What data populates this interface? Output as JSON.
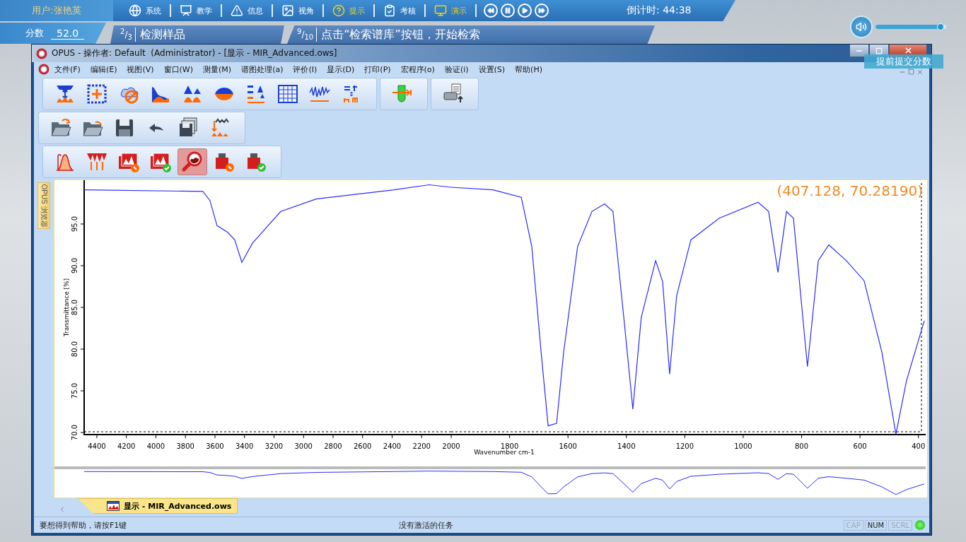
{
  "header": {
    "user": "用户:张艳英",
    "score_label": "分数",
    "score": "52.0",
    "nav": [
      {
        "kind": "globe",
        "label": "系统",
        "highlighted": false
      },
      {
        "kind": "teach",
        "label": "教学",
        "highlighted": false
      },
      {
        "kind": "warning",
        "label": "信息",
        "highlighted": false
      },
      {
        "kind": "picture",
        "label": "视角",
        "highlighted": false
      },
      {
        "kind": "help",
        "label": "提示",
        "highlighted": true
      },
      {
        "kind": "clipboard",
        "label": "考核",
        "highlighted": false
      },
      {
        "kind": "monitor",
        "label": "演示",
        "highlighted": true
      }
    ],
    "media": [
      {
        "kind": "rewind"
      },
      {
        "kind": "pause"
      },
      {
        "kind": "play"
      },
      {
        "kind": "forward"
      }
    ],
    "countdown": "倒计时: 44:38",
    "steps": [
      {
        "fraction": "$^{2}$/$_{3}$",
        "label": "检测样品"
      },
      {
        "fraction": "$^{9}$/$_{10}$",
        "label": "点击“检索谱库”按钮，开始检索"
      }
    ],
    "volume": {
      "level": 0.97
    }
  },
  "submit_button": "提前提交分数",
  "window": {
    "title": "OPUS - 操作者: Default  (Administrator) - [显示 - MIR_Advanced.ows]",
    "menu": [
      "文件(F)",
      "编辑(E)",
      "视图(V)",
      "窗口(W)",
      "测量(M)",
      "谱图处理(a)",
      "评价(I)",
      "显示(D)",
      "打印(P)",
      "宏程序(o)",
      "验证(i)",
      "设置(S)",
      "帮助(H)"
    ],
    "toolbars": [
      [
        [
          {
            "kind": "zoom-vertical",
            "selected": false
          },
          {
            "kind": "zoom-all",
            "selected": false
          },
          {
            "kind": "cloud",
            "selected": false
          },
          {
            "kind": "baseline",
            "selected": false
          },
          {
            "kind": "peaks",
            "selected": false
          },
          {
            "kind": "wave",
            "selected": false
          },
          {
            "kind": "subtract",
            "selected": false
          },
          {
            "kind": "table",
            "selected": false
          },
          {
            "kind": "noise",
            "selected": false
          },
          {
            "kind": "units",
            "selected": false
          }
        ],
        [
          {
            "kind": "tube",
            "selected": false
          }
        ],
        [
          {
            "kind": "printer",
            "selected": false
          }
        ]
      ],
      [
        [
          {
            "kind": "open",
            "selected": false
          },
          {
            "kind": "open-recent",
            "selected": false
          },
          {
            "kind": "save",
            "selected": false
          },
          {
            "kind": "undo",
            "selected": false
          },
          {
            "kind": "save-all",
            "selected": false
          },
          {
            "kind": "load",
            "selected": false
          }
        ]
      ],
      [
        [
          {
            "kind": "peak-curve",
            "selected": false
          },
          {
            "kind": "peak-pick",
            "selected": false
          },
          {
            "kind": "report-repair",
            "selected": false
          },
          {
            "kind": "report-check",
            "selected": false
          },
          {
            "kind": "search",
            "selected": true
          },
          {
            "kind": "weight-repair",
            "selected": false
          },
          {
            "kind": "weight-check",
            "selected": false
          }
        ]
      ]
    ],
    "side_tab": "OPUS 浏览器",
    "spectrum": [
      {
        "chart_data": {
          "type": "line",
          "ylabel": "Transmittance [%]",
          "xlim": [
            4486,
            2000
          ],
          "ylim": [
            69.75,
            100.25
          ],
          "xticks": [
            4400,
            4200,
            4000,
            3800,
            3600,
            3400,
            3200,
            3000,
            2800,
            2600,
            2400,
            2200,
            2000
          ],
          "yticks": [
            {
              "value": 70,
              "label": "70.0"
            },
            {
              "value": 75,
              "label": "75.0"
            },
            {
              "value": 80,
              "label": "80.0"
            },
            {
              "value": 85,
              "label": "85.0"
            },
            {
              "value": 90,
              "label": "90.0"
            },
            {
              "value": 95,
              "label": "95.0"
            }
          ],
          "x": [
            4486,
            3682,
            3634,
            3586,
            3514,
            3466,
            3418,
            3346,
            3155,
            2915,
            2580,
            2388,
            2149,
            2000
          ],
          "series": [
            {
              "color": "#2b2bff",
              "values": [
                99.1,
                98.9,
                97.8,
                94.8,
                94.0,
                93.1,
                90.4,
                92.7,
                96.5,
                98.0,
                98.7,
                99.1,
                99.7,
                99.4
              ]
            }
          ]
        }
      },
      {
        "chart_data": {
          "type": "line",
          "xlabel": "Wavenumber cm-1",
          "xlim": [
            2000,
            380
          ],
          "ylim": [
            69.75,
            100.25
          ],
          "xticks": [
            1800,
            1600,
            1400,
            1200,
            1000,
            800,
            600,
            400
          ],
          "x": [
            2000,
            1857,
            1760,
            1724,
            1692,
            1668,
            1639,
            1615,
            1567,
            1518,
            1475,
            1446,
            1409,
            1378,
            1349,
            1300,
            1276,
            1252,
            1228,
            1179,
            1082,
            949,
            913,
            881,
            852,
            828,
            780,
            743,
            707,
            647,
            586,
            525,
            477,
            441,
            380
          ],
          "series": [
            {
              "color": "#2b2bff",
              "values": [
                99.4,
                99.1,
                98.2,
                92.3,
                79.6,
                70.8,
                71.1,
                79.6,
                92.3,
                96.5,
                97.4,
                96.5,
                83.8,
                72.8,
                83.8,
                90.6,
                88.1,
                77.0,
                86.4,
                93.1,
                95.7,
                97.6,
                96.5,
                89.2,
                96.5,
                95.7,
                77.9,
                90.6,
                92.5,
                90.6,
                88.2,
                79.6,
                69.8,
                76.2,
                83.4
              ]
            }
          ],
          "annotations": [
            "(407.128, 70.28190)"
          ]
        }
      }
    ],
    "tabs": [
      {
        "label": "显示 - MIR_Advanced.ows",
        "selected": true
      }
    ],
    "status_bar": {
      "help": "要想得到帮助，请按F1键",
      "task": "没有激活的任务",
      "indicators": [
        {
          "label": "CAP",
          "on": false
        },
        {
          "label": "NUM",
          "on": true
        },
        {
          "label": "SCRL",
          "on": false
        }
      ]
    }
  }
}
